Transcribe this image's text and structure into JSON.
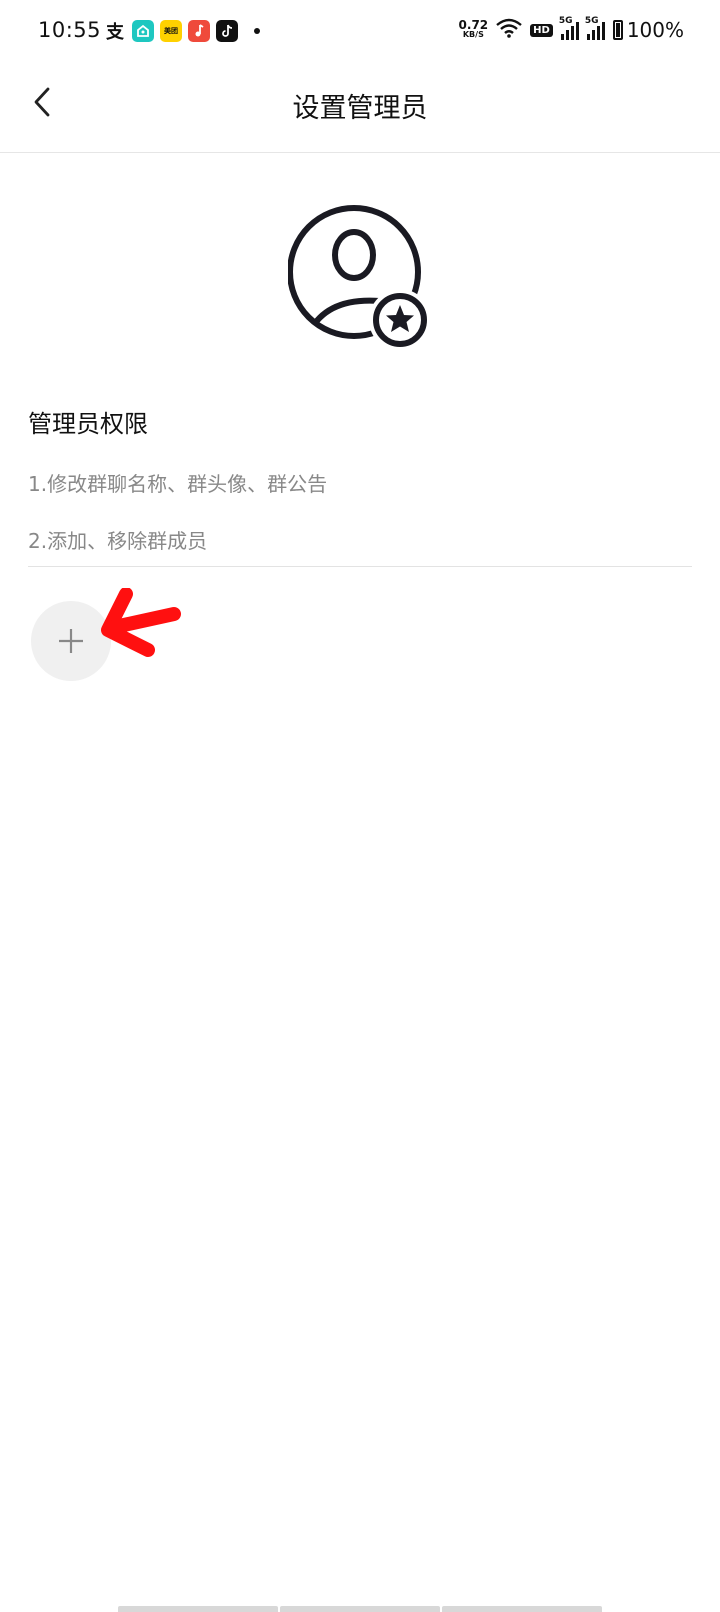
{
  "status_bar": {
    "time": "10:55",
    "net_speed_value": "0.72",
    "net_speed_unit": "KB/S",
    "hd_label": "HD",
    "signal1_label": "5G",
    "signal2_label": "5G",
    "battery_percent": "100%",
    "app_icons": [
      "alipay-icon",
      "xianyu-icon",
      "meituan-icon",
      "music-icon",
      "tiktok-icon"
    ],
    "meituan_label": "美团"
  },
  "nav": {
    "title": "设置管理员",
    "back_icon": "chevron-left-icon"
  },
  "avatar": {
    "icon": "admin-user-star-icon",
    "stroke_color": "#1a1a22"
  },
  "permissions": {
    "title": "管理员权限",
    "items": [
      "1.修改群聊名称、群头像、群公告",
      "2.添加、移除群成员"
    ]
  },
  "add_button": {
    "icon": "plus-icon"
  },
  "annotation": {
    "icon": "red-arrow-icon",
    "color": "#ff1010"
  }
}
